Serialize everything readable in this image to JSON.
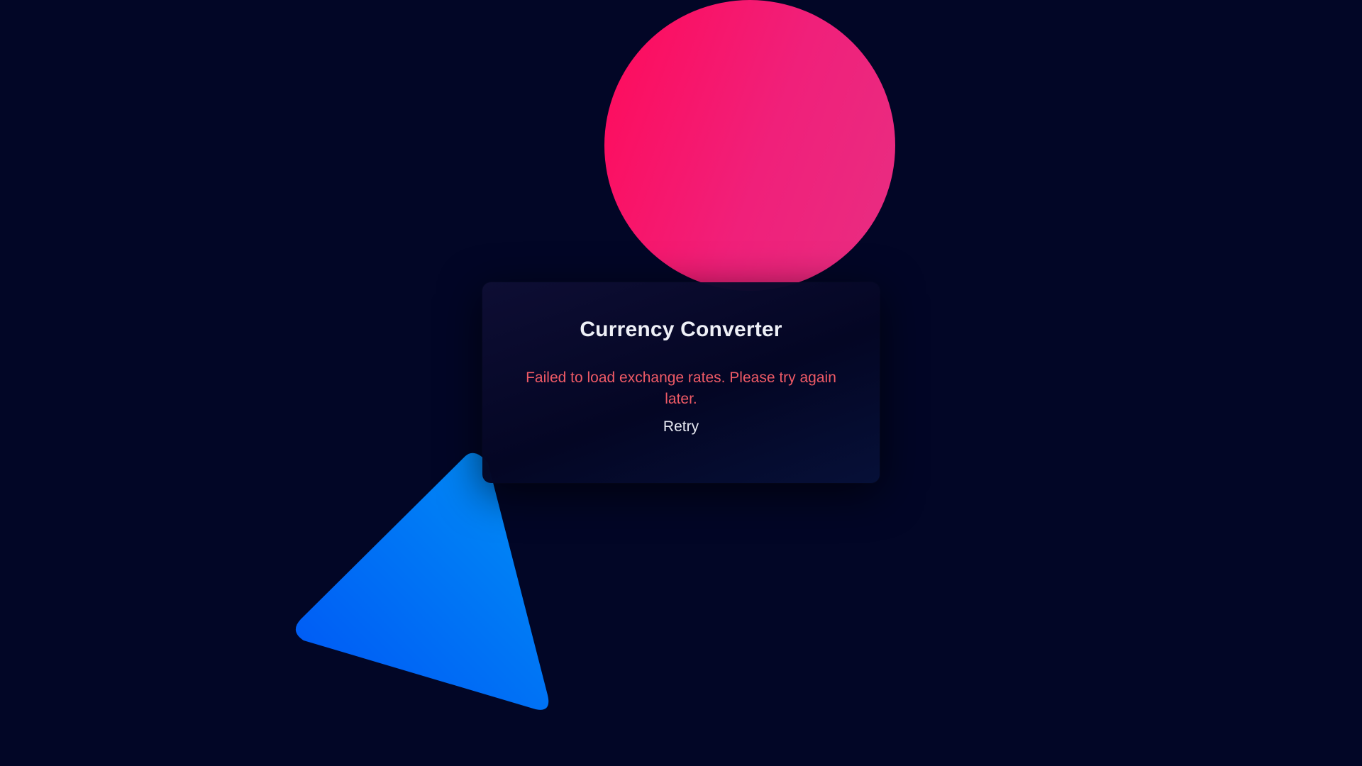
{
  "converter": {
    "title": "Currency Converter",
    "error_message": "Failed to load exchange rates. Please try again later.",
    "retry_label": "Retry"
  },
  "colors": {
    "background": "#020626",
    "circle_gradient": [
      "#ff0a5a",
      "#e82e82"
    ],
    "triangle_gradient": [
      "#0060ff",
      "#0085f5"
    ],
    "error_text": "#ef5a66",
    "title_text": "#eef0f7"
  },
  "decorations": [
    "pink-circle-shape",
    "blue-triangle-shape"
  ]
}
